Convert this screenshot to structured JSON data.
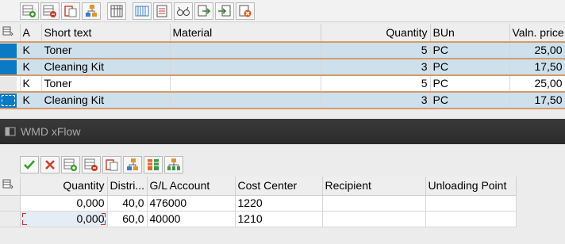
{
  "top_toolbar": {
    "icons": [
      "append-row-icon",
      "delete-row-icon",
      "copy-row-icon",
      "insert-tree-icon",
      "spreadsheet-icon",
      "columns-icon",
      "details-icon",
      "find-icon",
      "export-icon",
      "import-icon",
      "remove-icon"
    ]
  },
  "items_table": {
    "columns": [
      "A",
      "Short text",
      "Material",
      "Quantity",
      "BUn",
      "Valn. price"
    ],
    "rows": [
      {
        "a": "K",
        "short_text": "Toner",
        "material": "",
        "quantity": "5",
        "bun": "PC",
        "price": "25,00"
      },
      {
        "a": "K",
        "short_text": "Cleaning Kit",
        "material": "",
        "quantity": "3",
        "bun": "PC",
        "price": "17,50"
      },
      {
        "a": "K",
        "short_text": "Toner",
        "material": "",
        "quantity": "5",
        "bun": "PC",
        "price": "25,00"
      },
      {
        "a": "K",
        "short_text": "Cleaning Kit",
        "material": "",
        "quantity": "3",
        "bun": "PC",
        "price": "17,50"
      }
    ]
  },
  "section_bar": {
    "title": "WMD xFlow"
  },
  "bottom_toolbar": {
    "icons": [
      "check-icon",
      "cancel-icon",
      "append-row-icon",
      "delete-row-icon",
      "copy-row-icon",
      "insert-tree-icon",
      "columns-icon",
      "distribute-icon"
    ]
  },
  "account_table": {
    "columns": [
      "Quantity",
      "Distri...",
      "G/L Account",
      "Cost Center",
      "Recipient",
      "Unloading Point"
    ],
    "rows": [
      {
        "quantity": "0,000",
        "distri": "40,0",
        "gl_account": "476000",
        "cost_center": "1220",
        "recipient": "",
        "unloading": ""
      },
      {
        "quantity": "0,000",
        "distri": "60,0",
        "gl_account": "40000",
        "cost_center": "1210",
        "recipient": "",
        "unloading": ""
      }
    ]
  },
  "colors": {
    "accent": "#0a7ac4",
    "row_selected": "#cde0ec",
    "row_separator": "#d79a6a",
    "dark_bar": "#2f2f2f"
  }
}
